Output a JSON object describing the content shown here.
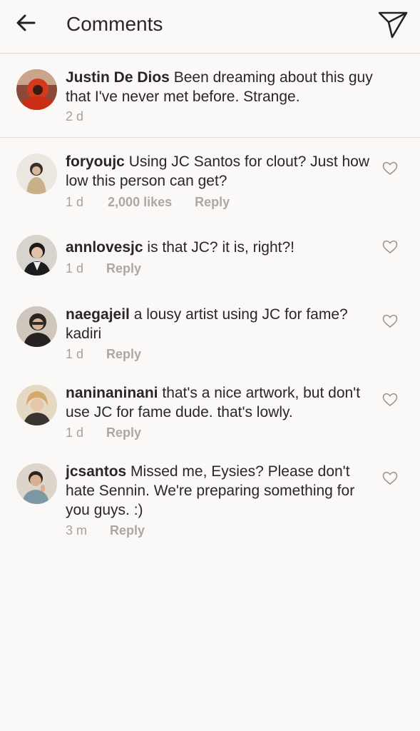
{
  "header": {
    "title": "Comments"
  },
  "caption": {
    "username": "Justin De Dios",
    "text": "Been dreaming about this guy that I've never met before. Strange.",
    "time": "2 d"
  },
  "comments": [
    {
      "username": "foryoujc",
      "text": "Using JC Santos for clout? Just how low this person can get?",
      "time": "1 d",
      "likes": "2,000 likes",
      "reply": "Reply"
    },
    {
      "username": "annlovesjc",
      "text": "is that JC? it is, right?!",
      "time": "1 d",
      "reply": "Reply"
    },
    {
      "username": "naegajeil",
      "text": "a lousy artist using JC for fame? kadiri",
      "time": "1 d",
      "reply": "Reply"
    },
    {
      "username": "naninaninani",
      "text": "that's a nice artwork, but don't use JC for fame dude. that's lowly.",
      "time": "1 d",
      "reply": "Reply"
    },
    {
      "username": "jcsantos",
      "text": "Missed me, Eysies? Please don't hate Sennin. We're preparing something for you guys. :)",
      "time": "3 m",
      "reply": "Reply"
    }
  ],
  "icons": {
    "back": "arrow-left-icon",
    "send": "paper-plane-icon",
    "like": "heart-outline-icon"
  },
  "colors": {
    "background": "#fbf9f7",
    "text": "#262222",
    "meta": "#aaa09c",
    "divider": "#e3dcd8"
  }
}
